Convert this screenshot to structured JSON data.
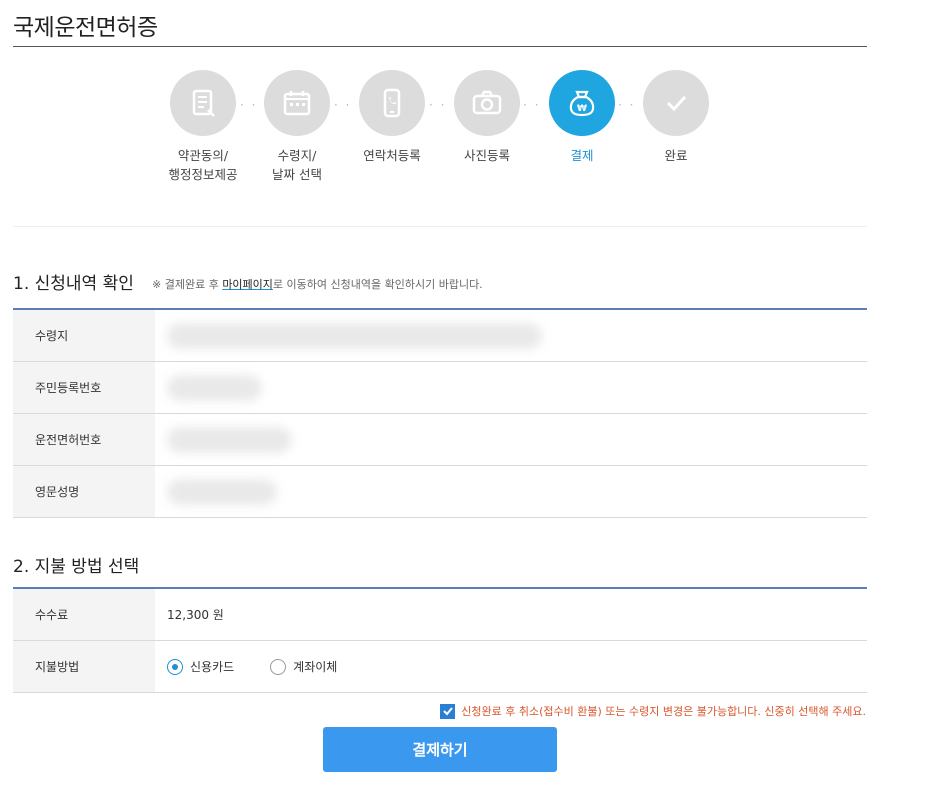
{
  "page_title": "국제운전면허증",
  "stepper": {
    "steps": [
      {
        "label": "약관동의/\n행정정보제공",
        "icon": "document-icon",
        "active": false
      },
      {
        "label": "수령지/\n날짜 선택",
        "icon": "calendar-icon",
        "active": false
      },
      {
        "label": "연락처등록",
        "icon": "phone-icon",
        "active": false
      },
      {
        "label": "사진등록",
        "icon": "camera-icon",
        "active": false
      },
      {
        "label": "결제",
        "icon": "won-bag-icon",
        "active": true
      },
      {
        "label": "완료",
        "icon": "check-icon",
        "active": false
      }
    ],
    "separator": "· ·"
  },
  "section1": {
    "title": "1. 신청내역 확인",
    "note_prefix": "※ 결제완료 후 ",
    "note_link": "마이페이지",
    "note_suffix": "로 이동하여 신청내역을 확인하시기 바랍니다.",
    "rows": [
      {
        "label": "수령지"
      },
      {
        "label": "주민등록번호"
      },
      {
        "label": "운전면허번호"
      },
      {
        "label": "영문성명"
      }
    ]
  },
  "section2": {
    "title": "2. 지불 방법 선택",
    "fee_label": "수수료",
    "fee_value": "12,300 원",
    "method_label": "지불방법",
    "methods": [
      {
        "label": "신용카드",
        "checked": true
      },
      {
        "label": "계좌이체",
        "checked": false
      }
    ]
  },
  "agreement": {
    "text": "신청완료 후 취소(접수비 환불) 또는 수령지 변경은 불가능합니다. 신중히 선택해 주세요.",
    "checked": true
  },
  "pay_button": "결제하기",
  "colors": {
    "accent": "#1fa6e0",
    "button": "#3a98ee",
    "warning_text": "#d8562c",
    "table_top_border": "#5b7fb3"
  }
}
